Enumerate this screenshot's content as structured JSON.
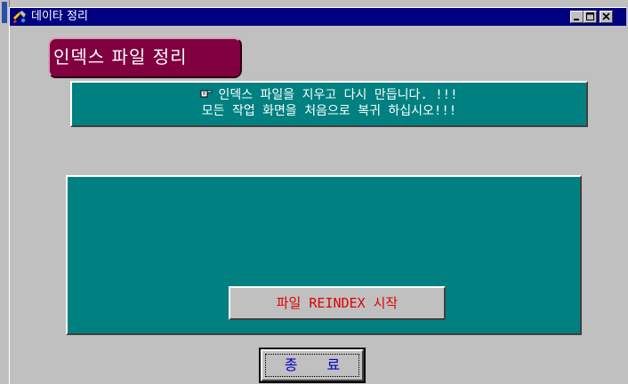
{
  "window": {
    "title": "데이타 정리",
    "icon": "tools-icon"
  },
  "heading": {
    "text": "인덱스 파일 정리"
  },
  "notice": {
    "icon": "pointing-hand-icon",
    "line1": "인덱스 파일을 지우고 다시 만듭니다. !!!",
    "line2": "모든 작업 화면을 처음으로 복귀 하십시오!!!"
  },
  "buttons": {
    "reindex_label": "파일 REINDEX 시작",
    "exit_label": "종 료"
  },
  "colors": {
    "title_bar": "#000080",
    "heading_bg": "#800040",
    "panel_bg": "#008080",
    "reindex_text": "#e00000",
    "exit_text": "#0000c0"
  }
}
